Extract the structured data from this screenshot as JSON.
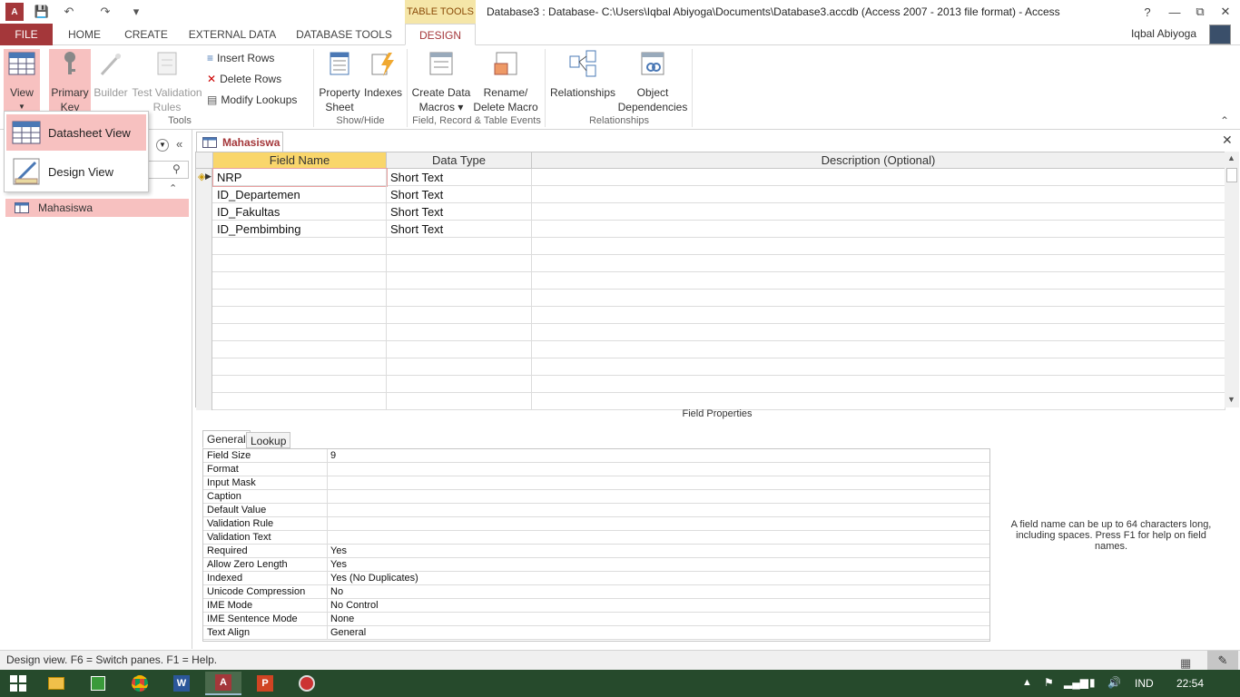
{
  "window": {
    "title": "Database3 : Database- C:\\Users\\Iqbal Abiyoga\\Documents\\Database3.accdb (Access 2007 - 2013 file format) - Access",
    "context_tab_group": "TABLE TOOLS",
    "user_name": "Iqbal Abiyoga",
    "help": "?",
    "minimize": "—",
    "restore": "⧉",
    "close": "✕"
  },
  "tabs": {
    "file": "FILE",
    "home": "HOME",
    "create": "CREATE",
    "external_data": "EXTERNAL DATA",
    "database_tools": "DATABASE TOOLS",
    "design": "DESIGN"
  },
  "ribbon": {
    "view": "View",
    "primary_key_1": "Primary",
    "primary_key_2": "Key",
    "builder": "Builder",
    "test_1": "Test Validation",
    "test_2": "Rules",
    "insert_rows": "Insert Rows",
    "delete_rows": "Delete Rows",
    "modify_lookups": "Modify Lookups",
    "property_1": "Property",
    "property_2": "Sheet",
    "indexes": "Indexes",
    "create_macros_1": "Create Data",
    "create_macros_2": "Macros",
    "rename_macro_1": "Rename/",
    "rename_macro_2": "Delete Macro",
    "relationships": "Relationships",
    "object_dep_1": "Object",
    "object_dep_2": "Dependencies",
    "group_tools": "Tools",
    "group_showhide": "Show/Hide",
    "group_events": "Field, Record & Table Events",
    "group_relationships": "Relationships"
  },
  "view_menu": {
    "datasheet": "Datasheet View",
    "design": "Design View"
  },
  "nav": {
    "item": "Mahasiswa"
  },
  "document": {
    "tab_label": "Mahasiswa",
    "close": "✕",
    "columns": [
      "Field Name",
      "Data Type",
      "Description (Optional)"
    ],
    "rows": [
      {
        "field": "NRP",
        "type": "Short Text",
        "desc": ""
      },
      {
        "field": "ID_Departemen",
        "type": "Short Text",
        "desc": ""
      },
      {
        "field": "ID_Fakultas",
        "type": "Short Text",
        "desc": ""
      },
      {
        "field": "ID_Pembimbing",
        "type": "Short Text",
        "desc": ""
      }
    ]
  },
  "field_properties": {
    "title": "Field Properties",
    "tab_general": "General",
    "tab_lookup": "Lookup",
    "props": [
      {
        "k": "Field Size",
        "v": "9"
      },
      {
        "k": "Format",
        "v": ""
      },
      {
        "k": "Input Mask",
        "v": ""
      },
      {
        "k": "Caption",
        "v": ""
      },
      {
        "k": "Default Value",
        "v": ""
      },
      {
        "k": "Validation Rule",
        "v": ""
      },
      {
        "k": "Validation Text",
        "v": ""
      },
      {
        "k": "Required",
        "v": "Yes"
      },
      {
        "k": "Allow Zero Length",
        "v": "Yes"
      },
      {
        "k": "Indexed",
        "v": "Yes (No Duplicates)"
      },
      {
        "k": "Unicode Compression",
        "v": "No"
      },
      {
        "k": "IME Mode",
        "v": "No Control"
      },
      {
        "k": "IME Sentence Mode",
        "v": "None"
      },
      {
        "k": "Text Align",
        "v": "General"
      }
    ],
    "help": "A field name can be up to 64 characters long, including spaces. Press F1 for help on field names."
  },
  "status": {
    "text": "Design view.  F6 = Switch panes.  F1 = Help."
  },
  "taskbar": {
    "lang": "IND",
    "time": "22:54"
  },
  "colors": {
    "accent": "#a4373a",
    "selected_row": "#f7c1c0",
    "taskbar": "#264a2c"
  }
}
